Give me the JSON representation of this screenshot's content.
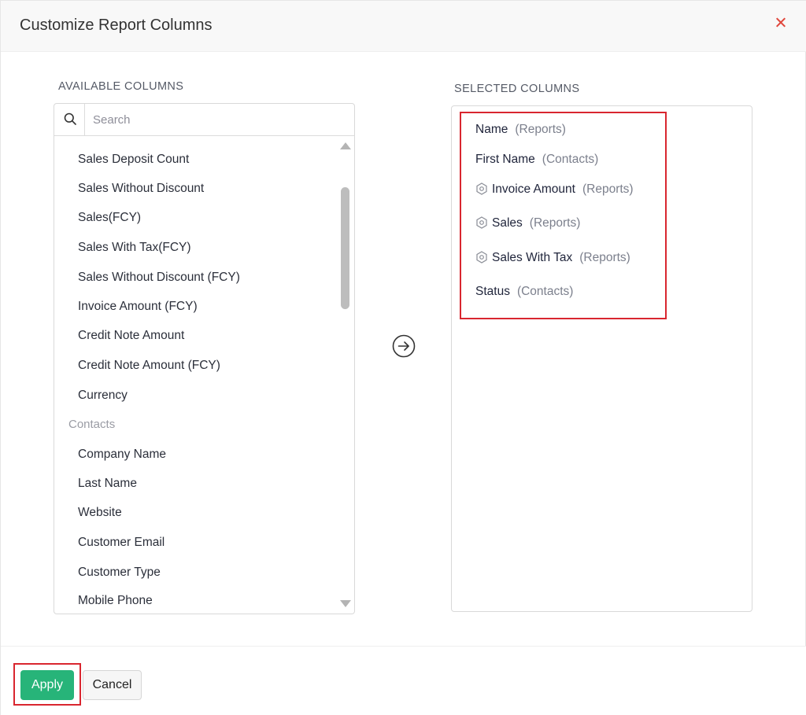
{
  "dialog": {
    "title": "Customize Report Columns"
  },
  "available": {
    "label": "AVAILABLE COLUMNS",
    "search_placeholder": "Search",
    "items": [
      "Sales Deposit Count",
      "Sales Without Discount",
      "Sales(FCY)",
      "Sales With Tax(FCY)",
      "Sales Without Discount (FCY)",
      "Invoice Amount (FCY)",
      "Credit Note Amount",
      "Credit Note Amount (FCY)",
      "Currency"
    ],
    "group_label": "Contacts",
    "contact_items": [
      "Company Name",
      "Last Name",
      "Website",
      "Customer Email",
      "Customer Type",
      "Mobile Phone"
    ]
  },
  "selected": {
    "label": "SELECTED COLUMNS",
    "items": [
      {
        "name": "Name",
        "source": "(Reports)",
        "icon": "none"
      },
      {
        "name": "First Name",
        "source": "(Contacts)",
        "icon": "none"
      },
      {
        "name": "Invoice Amount",
        "source": "(Reports)",
        "icon": "gear-icon"
      },
      {
        "name": "Sales",
        "source": "(Reports)",
        "icon": "gear-icon"
      },
      {
        "name": "Sales With Tax",
        "source": "(Reports)",
        "icon": "gear-icon"
      },
      {
        "name": "Status",
        "source": "(Contacts)",
        "icon": "none"
      }
    ]
  },
  "footer": {
    "apply_label": "Apply",
    "cancel_label": "Cancel"
  },
  "colors": {
    "apply": "#27b479",
    "highlight": "#d9262f",
    "close": "#e0463a"
  }
}
